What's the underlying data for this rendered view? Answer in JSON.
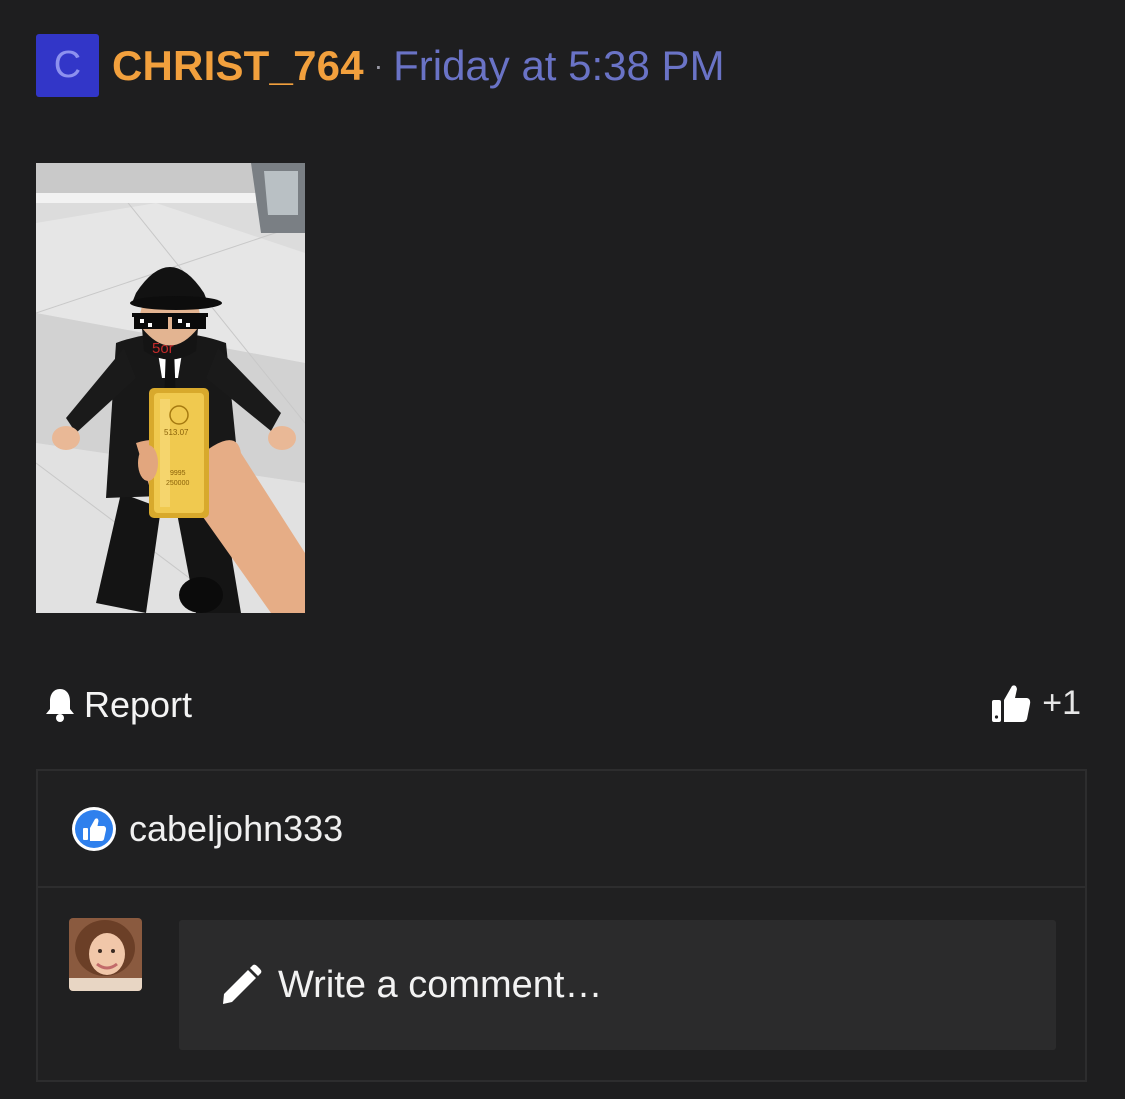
{
  "post": {
    "author_initial": "C",
    "author_name": "CHRIST_764",
    "separator": "·",
    "timestamp": "Friday at 5:38 PM"
  },
  "media": {
    "description_icon": "photo",
    "mask_text": "5or",
    "bar_text_1": "513.07",
    "bar_text_2": "9995",
    "bar_text_3": "250000"
  },
  "actions": {
    "report_label": "Report",
    "like_count": "+1"
  },
  "reactions": {
    "liker_name": "cabeljohn333"
  },
  "composer": {
    "placeholder": "Write a comment…"
  },
  "colors": {
    "background": "#1e1e1f",
    "username": "#f2a03d",
    "timestamp": "#6a73c6",
    "avatar_bg": "#3236c8",
    "like_badge": "#2f80ed"
  }
}
